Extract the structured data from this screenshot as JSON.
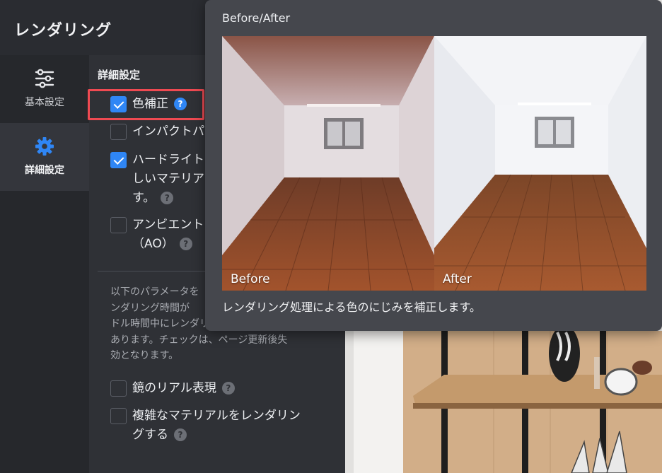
{
  "app": {
    "title": "レンダリング"
  },
  "sidebar": {
    "items": [
      {
        "label": "基本設定",
        "icon": "sliders-icon",
        "active": false
      },
      {
        "label": "詳細設定",
        "icon": "gear-icon",
        "active": true
      }
    ]
  },
  "settings": {
    "section_title": "詳細設定",
    "options": [
      {
        "label": "色補正",
        "checked": true
      },
      {
        "label": "インパクトパ",
        "checked": false
      },
      {
        "label_lines": [
          "ハードライト",
          "しいマテリア",
          "す。"
        ],
        "checked": true
      },
      {
        "label_lines": [
          "アンビエント",
          "（AO）"
        ],
        "checked": false
      }
    ],
    "note_lines": [
      "以下のパラメータを",
      "ンダリング時間が",
      "ドル時間中にレンダリングする可能性が",
      "あります。チェックは、ページ更新後失",
      "効となります。"
    ],
    "extra_options": [
      {
        "label": "鏡のリアル表現",
        "checked": false
      },
      {
        "label_lines": [
          "複雑なマテリアルをレンダリン",
          "グする"
        ],
        "checked": false
      }
    ]
  },
  "popover": {
    "title": "Before/After",
    "before_label": "Before",
    "after_label": "After",
    "description": "レンダリング処理による色のにじみを補正します。"
  },
  "colors": {
    "accent": "#2f86f5",
    "highlight": "#ef4a52"
  }
}
